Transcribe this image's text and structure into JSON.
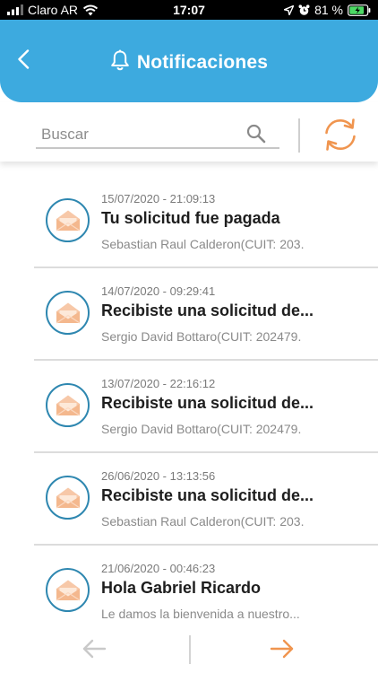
{
  "status_bar": {
    "carrier": "Claro AR",
    "time": "17:07",
    "battery": "81 %",
    "icons": [
      "signal-icon",
      "wifi-icon",
      "location-icon",
      "alarm-icon",
      "battery-icon"
    ]
  },
  "header": {
    "title": "Notificaciones",
    "icons": [
      "back-arrow-icon",
      "bell-icon"
    ],
    "background_color": "#3daadf"
  },
  "search": {
    "placeholder": "Buscar",
    "value": ""
  },
  "colors": {
    "accent_orange": "#f0954f",
    "envelope_fill": "#f7c8a8",
    "icon_ring": "#2e87b0",
    "disabled_arrow": "#c9c9c9"
  },
  "notifications": [
    {
      "date": "15/07/2020 - 21:09:13",
      "title": "Tu solicitud fue pagada",
      "subtitle": "Sebastian Raul Calderon(CUIT: 203.",
      "icon": "envelope-open-icon"
    },
    {
      "date": "14/07/2020 - 09:29:41",
      "title": "Recibiste una solicitud de...",
      "subtitle": "Sergio David Bottaro(CUIT: 202479.",
      "icon": "envelope-open-icon"
    },
    {
      "date": "13/07/2020 - 22:16:12",
      "title": "Recibiste una solicitud de...",
      "subtitle": "Sergio David Bottaro(CUIT: 202479.",
      "icon": "envelope-open-icon"
    },
    {
      "date": "26/06/2020 - 13:13:56",
      "title": "Recibiste una solicitud de...",
      "subtitle": "Sebastian Raul Calderon(CUIT: 203.",
      "icon": "envelope-open-icon"
    },
    {
      "date": "21/06/2020 - 00:46:23",
      "title": "Hola Gabriel Ricardo",
      "subtitle": "Le damos la bienvenida a nuestro...",
      "icon": "envelope-open-icon"
    }
  ],
  "pagination": {
    "prev_icon": "arrow-left-icon",
    "next_icon": "arrow-right-icon"
  }
}
